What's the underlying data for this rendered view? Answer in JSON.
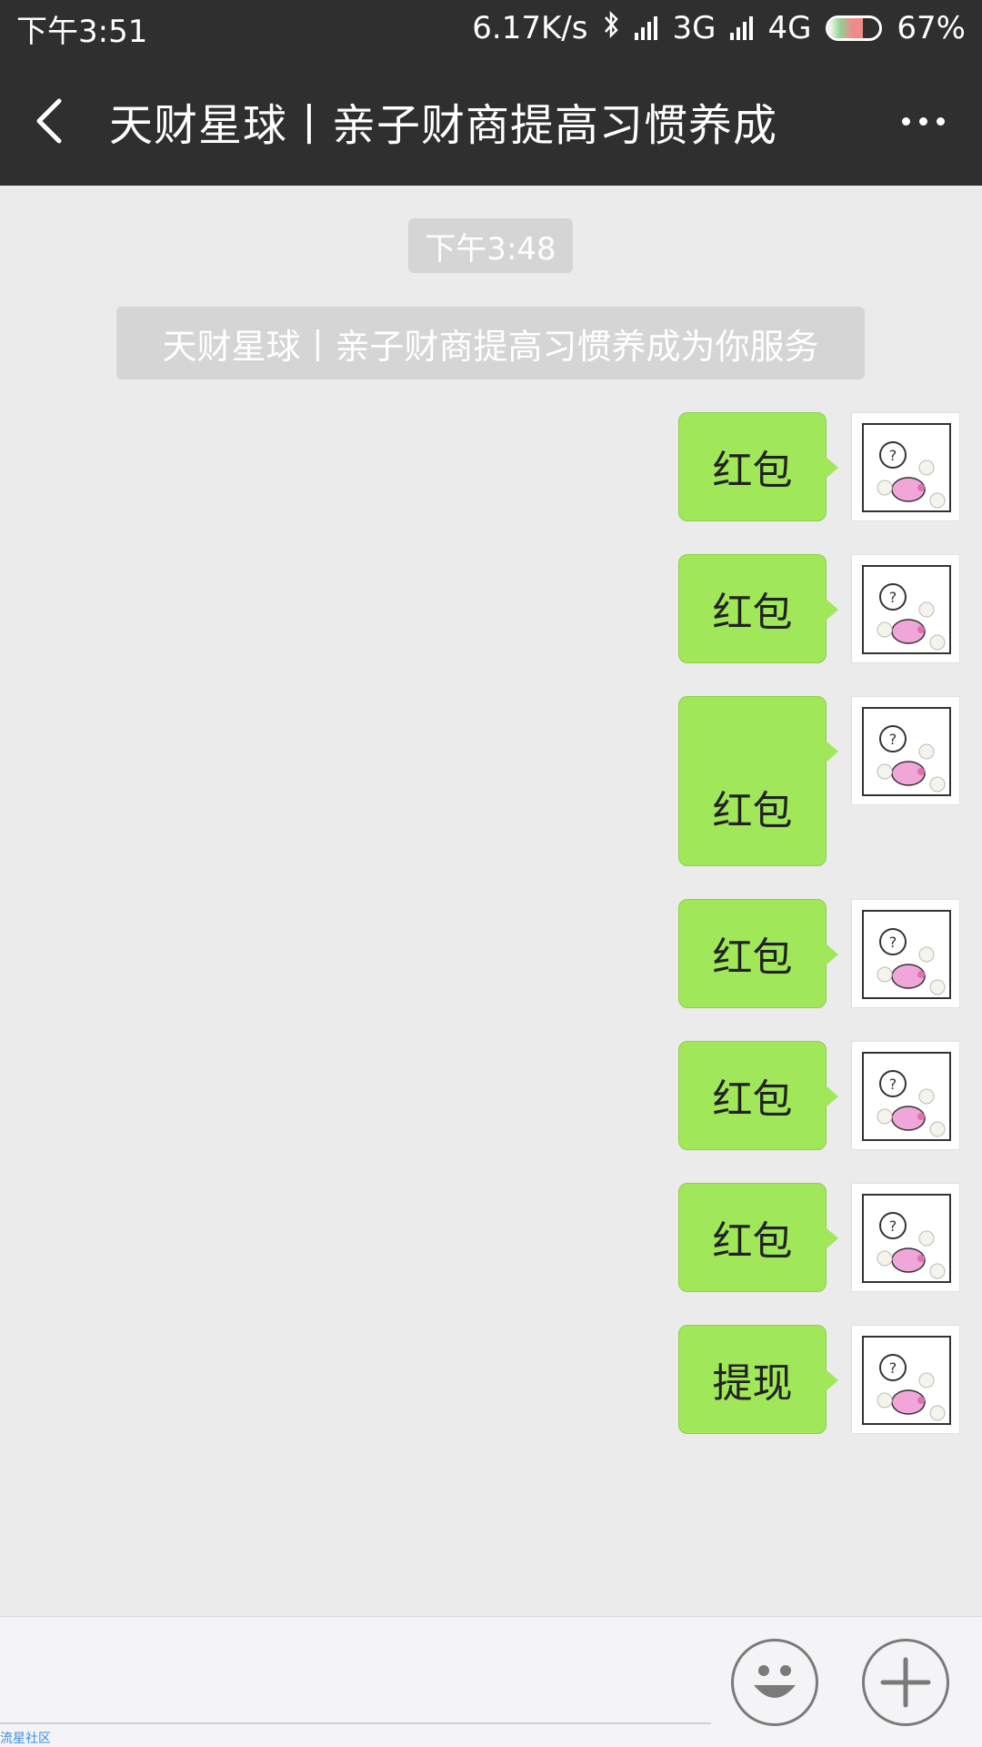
{
  "status_bar": {
    "time": "下午3:51",
    "net_speed": "6.17K/s",
    "network_1": "3G",
    "network_2": "4G",
    "battery": "67%",
    "battery_level": 0.67,
    "icons": [
      "bluetooth-icon",
      "signal-icon",
      "battery-icon"
    ]
  },
  "header": {
    "title": "天财星球丨亲子财商提高习惯养成",
    "back_icon": "chevron-left-icon",
    "more_icon": "more-dots-icon"
  },
  "chat": {
    "timestamp": "下午3:48",
    "system_note": "天财星球丨亲子财商提高习惯养成为你服务",
    "messages": [
      {
        "text": "红包",
        "sender": "me"
      },
      {
        "text": "红包",
        "sender": "me"
      },
      {
        "text": "红包",
        "sender": "me"
      },
      {
        "text": "红包",
        "sender": "me"
      },
      {
        "text": "红包",
        "sender": "me"
      },
      {
        "text": "红包",
        "sender": "me"
      },
      {
        "text": "提现",
        "sender": "me"
      }
    ]
  },
  "input_bar": {
    "emoji_icon": "emoji-icon",
    "plus_icon": "plus-icon"
  },
  "watermark": "流星社区",
  "colors": {
    "header_bg": "#2f2f2f",
    "chat_bg": "#ebebeb",
    "bubble_green": "#a0e75a",
    "system_bubble": "#d5d5d5"
  }
}
